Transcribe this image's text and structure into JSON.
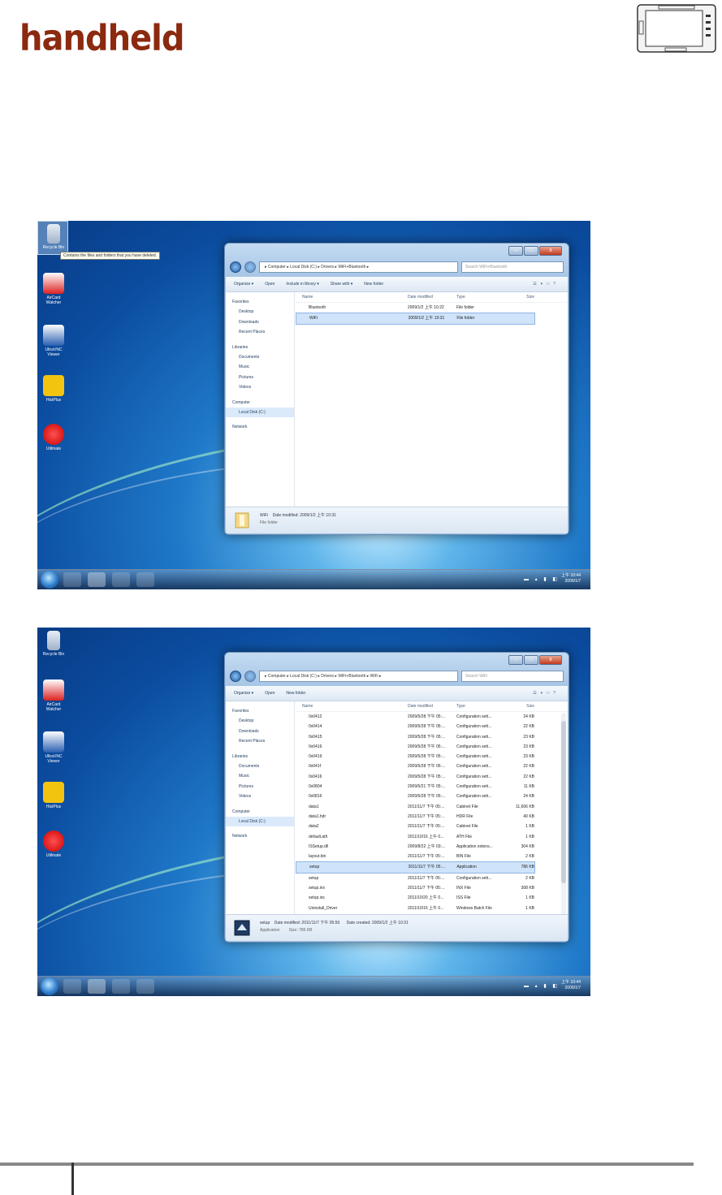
{
  "header": {
    "brand": "handheld",
    "device_image": "rugged-tablet-photo"
  },
  "screenshot1": {
    "desktop_icons": [
      "Recycle Bin",
      "AirCard Watcher",
      "UltraVNC Viewer",
      "HistPlus",
      "Utilmate"
    ],
    "tooltip": "Contains the files and folders that you have deleted.",
    "address": "▸ Computer ▸ Local Disk (C:) ▸ Drivers ▸ WiFi+Bluetooth ▸",
    "search_placeholder": "Search WiFi+Bluetooth",
    "toolbar": [
      "Organize ▾",
      "Open",
      "Include in library ▾",
      "Share with ▾",
      "New folder"
    ],
    "nav": {
      "favorites": "Favorites",
      "desktop": "Desktop",
      "downloads": "Downloads",
      "recent": "Recent Places",
      "libraries": "Libraries",
      "documents": "Documents",
      "music": "Music",
      "pictures": "Pictures",
      "videos": "Videos",
      "computer": "Computer",
      "localdisk": "Local Disk (C:)",
      "network": "Network"
    },
    "columns": [
      "Name",
      "Date modified",
      "Type",
      "Size"
    ],
    "rows": [
      {
        "name": "Bluetooth",
        "date": "2009/1/2 上午 10:22",
        "type": "File folder",
        "size": ""
      },
      {
        "name": "WiFi",
        "date": "2009/1/2 上午 10:31",
        "type": "File folder",
        "size": ""
      }
    ],
    "status_name": "WiFi",
    "status_modified": "Date modified: 2009/1/2 上午 10:31",
    "status_type": "File folder",
    "clock_time": "上午 10:44",
    "clock_date": "2009/1/7"
  },
  "screenshot2": {
    "desktop_icons": [
      "Recycle Bin",
      "AirCard Watcher",
      "UltraVNC Viewer",
      "HistPlus",
      "Utilmate"
    ],
    "address": "▸ Computer ▸ Local Disk (C:) ▸ Drivers ▸ WiFi+Bluetooth ▸ WiFi ▸",
    "search_placeholder": "Search WiFi",
    "toolbar": [
      "Organize ▾",
      "Open",
      "New folder"
    ],
    "nav": {
      "favorites": "Favorites",
      "desktop": "Desktop",
      "downloads": "Downloads",
      "recent": "Recent Places",
      "libraries": "Libraries",
      "documents": "Documents",
      "music": "Music",
      "pictures": "Pictures",
      "videos": "Videos",
      "computer": "Computer",
      "localdisk": "Local Disk (C:)",
      "network": "Network"
    },
    "columns": [
      "Name",
      "Date modified",
      "Type",
      "Size"
    ],
    "rows": [
      {
        "name": "0x0412",
        "date": "2009/5/28 下午 05:...",
        "type": "Configuration sett...",
        "size": "24 KB"
      },
      {
        "name": "0x0414",
        "date": "2009/5/28 下午 05:...",
        "type": "Configuration sett...",
        "size": "22 KB"
      },
      {
        "name": "0x0415",
        "date": "2009/5/28 下午 05:...",
        "type": "Configuration sett...",
        "size": "23 KB"
      },
      {
        "name": "0x0416",
        "date": "2009/5/28 下午 05:...",
        "type": "Configuration sett...",
        "size": "23 KB"
      },
      {
        "name": "0x0419",
        "date": "2009/5/28 下午 05:...",
        "type": "Configuration sett...",
        "size": "23 KB"
      },
      {
        "name": "0x041f",
        "date": "2009/5/28 下午 05:...",
        "type": "Configuration sett...",
        "size": "22 KB"
      },
      {
        "name": "0x0416",
        "date": "2009/5/28 下午 05:...",
        "type": "Configuration sett...",
        "size": "22 KB"
      },
      {
        "name": "0x0804",
        "date": "2009/5/21 下午 05:...",
        "type": "Configuration sett...",
        "size": "11 KB"
      },
      {
        "name": "0x0816",
        "date": "2009/5/28 下午 05:...",
        "type": "Configuration sett...",
        "size": "24 KB"
      },
      {
        "name": "data1",
        "date": "2011/11/7 下午 05:...",
        "type": "Cabinet File",
        "size": "11,606 KB"
      },
      {
        "name": "data1.hdr",
        "date": "2011/11/7 下午 05:...",
        "type": "HDR File",
        "size": "40 KB"
      },
      {
        "name": "data2",
        "date": "2011/11/7 下午 05:...",
        "type": "Cabinet File",
        "size": "1 KB"
      },
      {
        "name": "default.ath",
        "date": "2011/10/16 上午 0...",
        "type": "ATH File",
        "size": "1 KB"
      },
      {
        "name": "ISSetup.dll",
        "date": "2009/8/22 上午 03:...",
        "type": "Application extens...",
        "size": "304 KB"
      },
      {
        "name": "layout.bin",
        "date": "2011/11/7 下午 05:...",
        "type": "BIN File",
        "size": "2 KB"
      },
      {
        "name": "setup",
        "date": "2011/11/7 下午 05:...",
        "type": "Application",
        "size": "786 KB"
      },
      {
        "name": "setup",
        "date": "2011/11/7 下午 05:...",
        "type": "Configuration sett...",
        "size": "2 KB"
      },
      {
        "name": "setup.inx",
        "date": "2011/11/7 下午 05:...",
        "type": "INX File",
        "size": "308 KB"
      },
      {
        "name": "setup.iss",
        "date": "2011/10/20 上午 0...",
        "type": "ISS File",
        "size": "1 KB"
      },
      {
        "name": "Uninstall_Driver",
        "date": "2011/10/16 上午 0...",
        "type": "Windows Batch File",
        "size": "1 KB"
      }
    ],
    "selected_row": 15,
    "status_name": "setup",
    "status_modified": "Date modified: 2011/11/7 下午 05:59",
    "status_created": "Date created: 2009/1/2 上午 10:31",
    "status_type": "Application",
    "status_size": "Size: 786 KB",
    "clock_time": "上午 10:44",
    "clock_date": "2009/1/7"
  }
}
